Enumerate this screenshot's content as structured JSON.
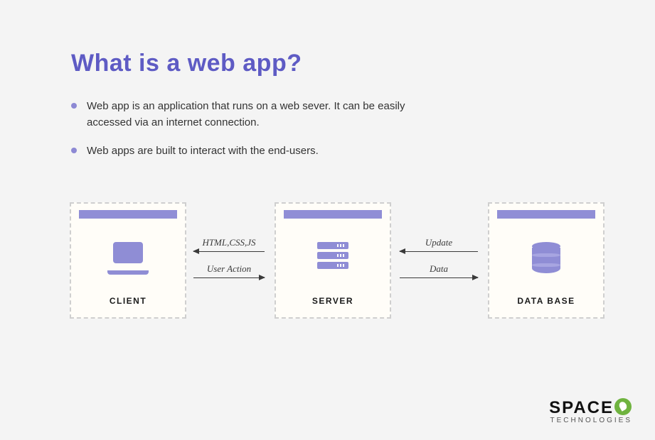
{
  "title": "What is a web app?",
  "bullets": [
    "Web app is an application that runs on a web sever. It can be easily accessed via an internet connection.",
    "Web apps are built to interact with the end-users."
  ],
  "nodes": {
    "client": {
      "label": "CLIENT",
      "icon": "laptop-icon"
    },
    "server": {
      "label": "SERVER",
      "icon": "server-icon"
    },
    "database": {
      "label": "DATA BASE",
      "icon": "database-icon"
    }
  },
  "connections": {
    "server_to_client": "HTML,CSS,JS",
    "client_to_server": "User Action",
    "db_to_server": "Update",
    "server_to_db": "Data"
  },
  "brand": {
    "line1_pre": "SPACE",
    "line2": "TECHNOLOGIES"
  },
  "colors": {
    "accent": "#5e5bc4",
    "node_bar": "#908ed6",
    "icon": "#8f8dd5",
    "leaf": "#6fb33f"
  }
}
